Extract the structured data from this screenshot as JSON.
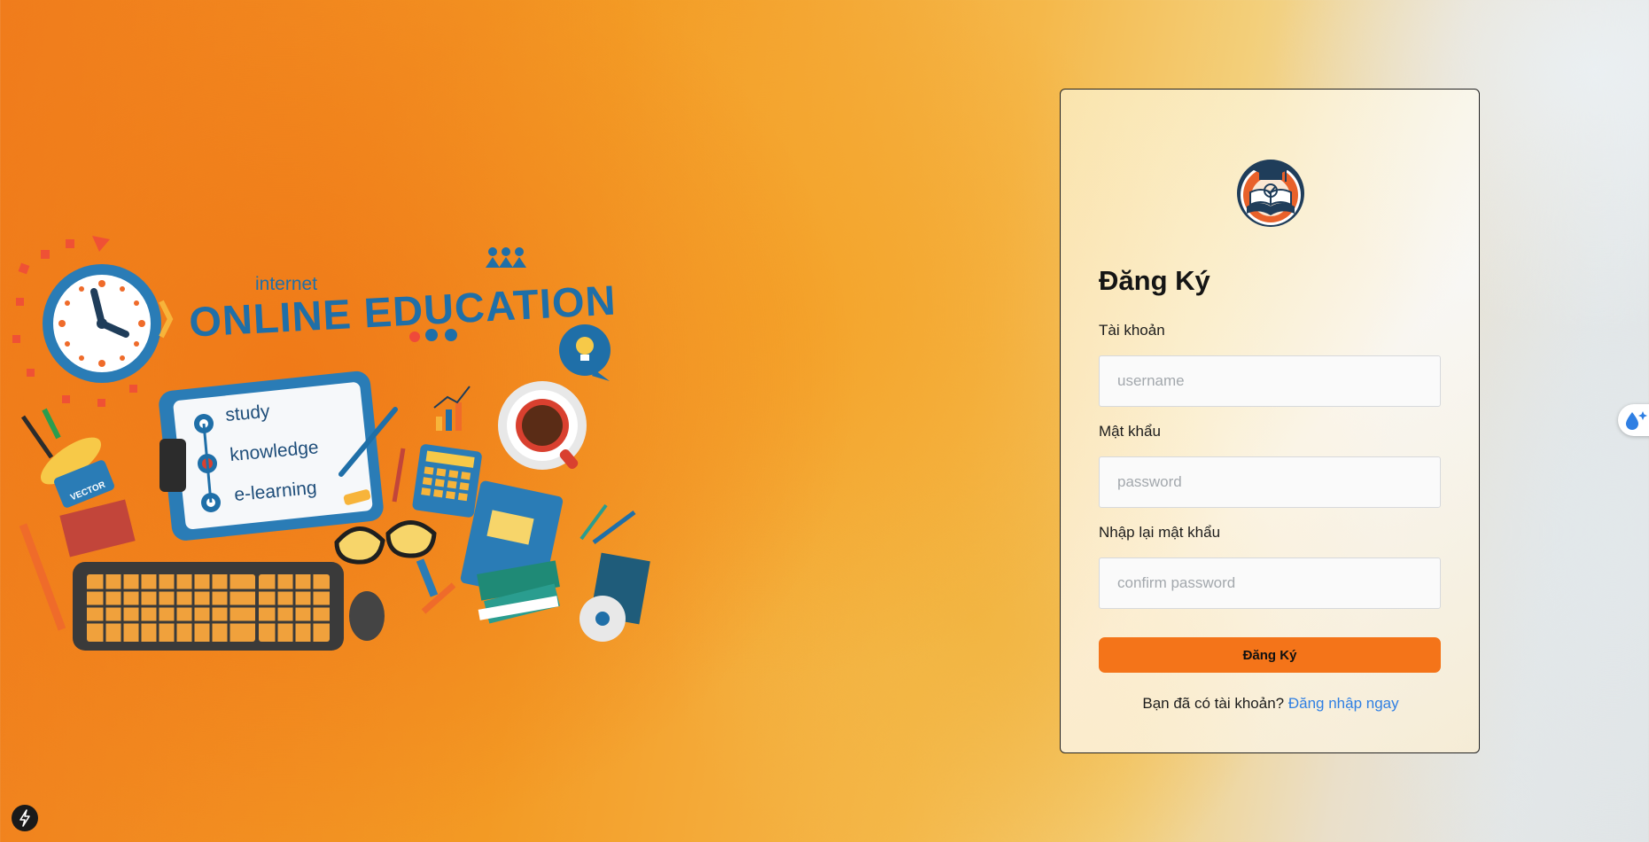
{
  "illustration": {
    "heading_small": "internet",
    "heading_main": "ONLINE EDUCATION",
    "clipboard_items": [
      "study",
      "knowledge",
      "e-learning"
    ],
    "tag_text": "VECTOR"
  },
  "register_form": {
    "title": "Đăng Ký",
    "username_label": "Tài khoản",
    "username_placeholder": "username",
    "username_value": "",
    "password_label": "Mật khẩu",
    "password_placeholder": "password",
    "password_value": "",
    "confirm_label": "Nhập lại mật khẩu",
    "confirm_placeholder": "confirm password",
    "confirm_value": "",
    "submit_label": "Đăng Ký",
    "footer_text": "Bạn đã có tài khoản?",
    "login_link": "Đăng nhập ngay"
  },
  "icons": {
    "logo": "graduation-book-logo-icon",
    "side_widget": "water-drop-sparkle-icon",
    "corner_button": "lightning-icon"
  },
  "colors": {
    "primary_button": "#f47419",
    "link": "#2f7fe3",
    "logo_ring": "#e8612a",
    "illustration_blue": "#1f6fa8"
  }
}
